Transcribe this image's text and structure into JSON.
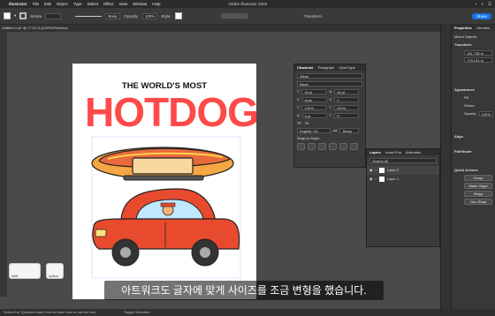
{
  "menubar": {
    "app": "Illustrator",
    "items": [
      "File",
      "Edit",
      "Object",
      "Type",
      "Select",
      "Effect",
      "View",
      "Window",
      "Help"
    ],
    "title": "Adobe Illustrator 2025"
  },
  "controlbar": {
    "stroke_label": "Stroke",
    "basic_label": "Basic",
    "opacity_label": "Opacity:",
    "opacity_value": "100%",
    "style_label": "Style:",
    "transform_label": "Transform",
    "share_label": "Share"
  },
  "document_tab": "Untitled-1.ai* @ 77.01 % (CMYK/Preview)",
  "artwork": {
    "headline_small": "THE WORLD'S MOST",
    "headline_big": "HOTDOG"
  },
  "character_panel": {
    "tabs": [
      "Character",
      "Paragraph",
      "OpenType"
    ],
    "search_placeholder": "Alfrae",
    "font_style": "Black",
    "size": "40 pt",
    "leading": "48 pt",
    "kerning": "Auto",
    "tracking": "0",
    "scale_v": "100%",
    "scale_h": "100%",
    "baseline": "0 pt",
    "rotate": "0°",
    "language": "English: UK",
    "aa": "Sharp",
    "snap_label": "Snap to Glyph"
  },
  "layers_panel": {
    "tabs": [
      "Layers",
      "Asset Exp",
      "Artboards"
    ],
    "search_placeholder": "Search All",
    "layers": [
      "Layer 2",
      "Layer 1"
    ]
  },
  "properties_panel": {
    "tabs": [
      "Properties",
      "Libraries"
    ],
    "mixed": "Mixed Objects",
    "transform_label": "Transform",
    "x_value": "181.738 m",
    "y_value": "178.134 m",
    "appearance_label": "Appearance",
    "fill_label": "Fill",
    "stroke_label": "Stroke",
    "opacity_label": "Opacity",
    "opacity_value": "100%",
    "align_label": "Align",
    "pathfinder_label": "Pathfinder",
    "quick_actions_label": "Quick Actions",
    "btn_group": "Group",
    "btn_make_clipping": "Make Clippi",
    "btn_retype": "Retyp",
    "btn_gen_shape": "Gen Shap"
  },
  "status_text": "Select the 'Question mark' icon to learn how to use the tool.",
  "status_toggle": "Toggle Selection",
  "subtitle_text": "아트워크도 글자에 맞게 사이즈를 조금 변형을 했습니다.",
  "keys": {
    "shift": "shift",
    "option": "option"
  },
  "colors": {
    "hotdog_red": "#ff4a4a",
    "bun": "#f4a742",
    "sausage": "#e86a3c",
    "car": "#e84a2e",
    "ui_dark": "#383838"
  }
}
